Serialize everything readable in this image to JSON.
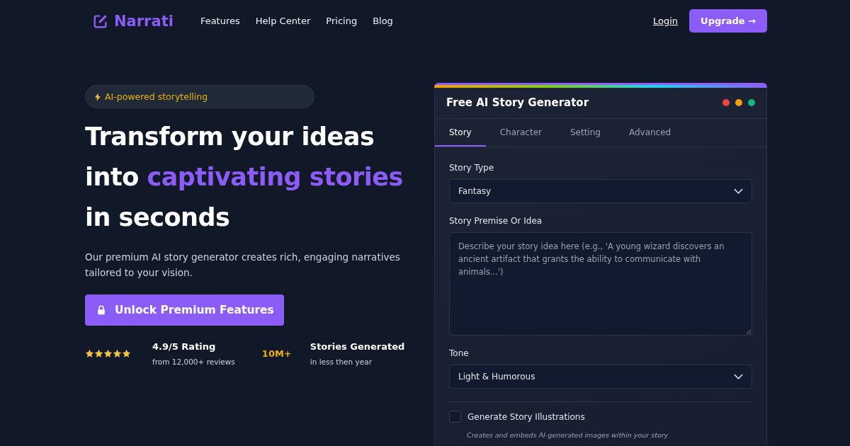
{
  "nav": {
    "brand": "Narrati",
    "links": [
      "Features",
      "Help Center",
      "Pricing",
      "Blog"
    ],
    "login": "Login",
    "upgrade": "Upgrade →"
  },
  "hero": {
    "badge": "AI-powered storytelling",
    "headline": {
      "before": "Transform your ideas into",
      "highlight": "captivating stories",
      "after": "in seconds"
    },
    "description": "Our premium AI story generator creates rich, engaging narratives tailored to your vision.",
    "cta": "Unlock Premium Features",
    "rating": {
      "stars": 5,
      "title": "4.9/5 Rating",
      "subtitle": "from 12,000+ reviews"
    },
    "stat": {
      "value": "10M+",
      "title": "Stories Generated",
      "subtitle": "in less then year"
    }
  },
  "generator": {
    "title": "Free AI Story Generator",
    "tabs": [
      {
        "label": "Story",
        "selected": true
      },
      {
        "label": "Character",
        "selected": false
      },
      {
        "label": "Setting",
        "selected": false
      },
      {
        "label": "Advanced",
        "selected": false
      }
    ],
    "story_type": {
      "label": "Story Type",
      "value": "Fantasy"
    },
    "premise": {
      "label": "Story Premise Or Idea",
      "placeholder": "Describe your story idea here (e.g., 'A young wizard discovers an ancient artifact that grants the ability to communicate with animals...')"
    },
    "tone": {
      "label": "Tone",
      "value": "Light & Humorous"
    },
    "illustrations": {
      "label": "Generate Story Illustrations",
      "checked": false,
      "hint": "Creates and embeds AI-generated images within your story"
    }
  }
}
